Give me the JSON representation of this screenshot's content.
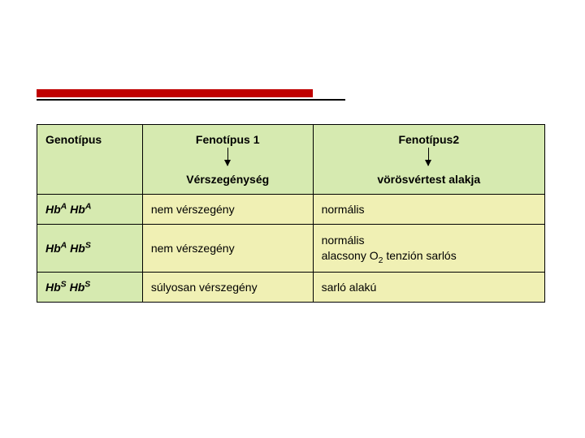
{
  "table": {
    "headers": {
      "genotype": "Genotípus",
      "phenotype1": "Fenotípus 1",
      "phenotype1_sub": "Vérszegénység",
      "phenotype2": "Fenotípus2",
      "phenotype2_sub": "vörösvértest alakja"
    },
    "rows": [
      {
        "genotype_allele1_base": "Hb",
        "genotype_allele1_sup": "A",
        "genotype_allele2_base": "Hb",
        "genotype_allele2_sup": "A",
        "phenotype1": "nem vérszegény",
        "phenotype2_line1": "normális",
        "phenotype2_line2": ""
      },
      {
        "genotype_allele1_base": "Hb",
        "genotype_allele1_sup": "A",
        "genotype_allele2_base": "Hb",
        "genotype_allele2_sup": "S",
        "phenotype1": "nem vérszegény",
        "phenotype2_line1": "normális",
        "phenotype2_o2_pre": "alacsony O",
        "phenotype2_o2_sub": "2",
        "phenotype2_o2_post": " tenzión sarlós"
      },
      {
        "genotype_allele1_base": "Hb",
        "genotype_allele1_sup": "S",
        "genotype_allele2_base": "Hb",
        "genotype_allele2_sup": "S",
        "phenotype1": "súlyosan vérszegény",
        "phenotype2_line1": "sarló alakú",
        "phenotype2_line2": ""
      }
    ]
  }
}
